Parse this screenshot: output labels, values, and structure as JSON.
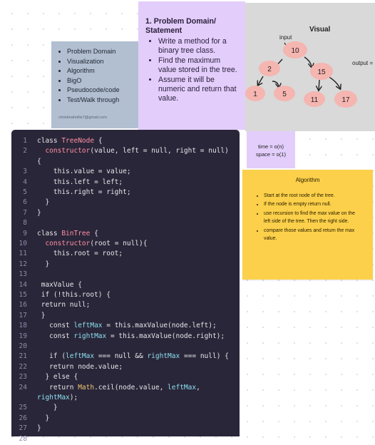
{
  "toc": {
    "items": [
      "Problem Domain",
      "Visualization",
      "Algorithm",
      "BigO",
      "Pseudocode/code",
      "Test/Walk through"
    ],
    "email": "christinahollis7@gmail.com"
  },
  "problem": {
    "title_num": "1.",
    "title": "Problem Domain/ Statement",
    "bullets": [
      "Write a method for a binary tree class.",
      "Find the maximum value stored in the tree.",
      "Assume it will be numeric and return that value."
    ]
  },
  "visual": {
    "title": "Visual",
    "input_label": "input",
    "output_label": "output =",
    "nodes": [
      "10",
      "2",
      "15",
      "1",
      "5",
      "11",
      "17"
    ],
    "colors": {
      "node_fill": "#f5b5b0",
      "panel_bg": "#d9d9d9"
    }
  },
  "complexity": {
    "time": "time = o(n)",
    "space": "space = o(1)"
  },
  "algorithm": {
    "title": "Algorithm",
    "steps": [
      "Start at the root node of the tree.",
      "If the node is empty return null.",
      "use recursion to find the max value on the left side of the tree. Then the right side.",
      "compare those values and return the max value."
    ]
  },
  "code": {
    "lines": [
      {
        "n": "1",
        "t": "class TreeNode {"
      },
      {
        "n": "2",
        "t": "  constructor(value, left = null, right = null)"
      },
      {
        "n": "",
        "t": "{"
      },
      {
        "n": "3",
        "t": "    this.value = value;"
      },
      {
        "n": "4",
        "t": "    this.left = left;"
      },
      {
        "n": "5",
        "t": "    this.right = right;"
      },
      {
        "n": "6",
        "t": "  }"
      },
      {
        "n": "7",
        "t": "}"
      },
      {
        "n": "8",
        "t": ""
      },
      {
        "n": "9",
        "t": "class BinTree {"
      },
      {
        "n": "10",
        "t": "  constructor(root = null){"
      },
      {
        "n": "11",
        "t": "    this.root = root;"
      },
      {
        "n": "12",
        "t": "  }"
      },
      {
        "n": "13",
        "t": ""
      },
      {
        "n": "14",
        "t": " maxValue {"
      },
      {
        "n": "15",
        "t": " if (!this.root) {"
      },
      {
        "n": "16",
        "t": " return null;"
      },
      {
        "n": "17",
        "t": " }"
      },
      {
        "n": "18",
        "t": "   const leftMax = this.maxValue(node.left);"
      },
      {
        "n": "19",
        "t": "   const rightMax = this.maxValue(node.right);"
      },
      {
        "n": "20",
        "t": ""
      },
      {
        "n": "21",
        "t": "   if (leftMax === null && rightMax === null) {"
      },
      {
        "n": "22",
        "t": "   return node.value;"
      },
      {
        "n": "23",
        "t": "  } else {"
      },
      {
        "n": "24",
        "t": "   return Math.ceil(node.value, leftMax,"
      },
      {
        "n": "",
        "t": "rightMax);"
      },
      {
        "n": "25",
        "t": "    }"
      },
      {
        "n": "26",
        "t": "  }"
      },
      {
        "n": "27",
        "t": "}"
      },
      {
        "n": "28",
        "t": ""
      }
    ]
  }
}
